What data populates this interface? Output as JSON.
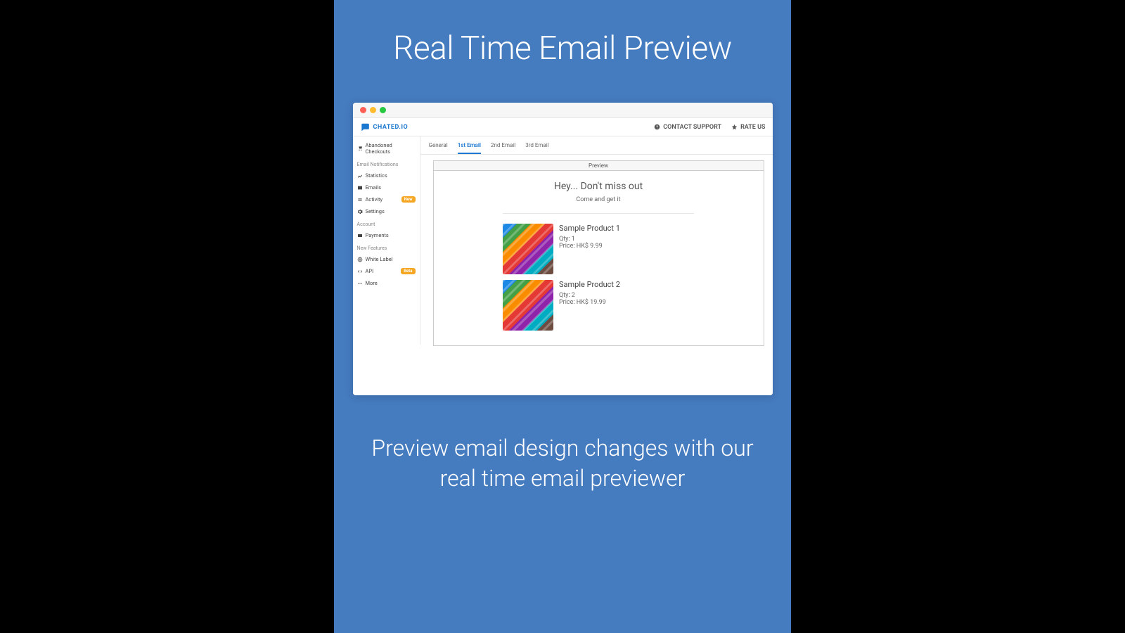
{
  "marketing": {
    "headline": "Real Time Email Preview",
    "caption": "Preview email design changes with our real time email previewer"
  },
  "brand": {
    "name": "CHATED.IO"
  },
  "topbar": {
    "contact": "CONTACT SUPPORT",
    "rate": "RATE US"
  },
  "sidebar": {
    "top_item": "Abandoned Checkouts",
    "groups": [
      {
        "label": "Email Notifications",
        "items": [
          {
            "label": "Statistics",
            "badge": null
          },
          {
            "label": "Emails",
            "badge": null
          },
          {
            "label": "Activity",
            "badge": "New"
          },
          {
            "label": "Settings",
            "badge": null
          }
        ]
      },
      {
        "label": "Account",
        "items": [
          {
            "label": "Payments",
            "badge": null
          }
        ]
      },
      {
        "label": "New Features",
        "items": [
          {
            "label": "White Label",
            "badge": null
          },
          {
            "label": "API",
            "badge": "Beta"
          },
          {
            "label": "More",
            "badge": null
          }
        ]
      }
    ]
  },
  "tabs": {
    "items": [
      "General",
      "1st Email",
      "2nd Email",
      "3rd Email"
    ],
    "active_index": 1
  },
  "preview": {
    "panel_label": "Preview",
    "email_heading": "Hey... Don't miss out",
    "email_subheading": "Come and get it",
    "products": [
      {
        "name": "Sample Product 1",
        "qty": "Qty: 1",
        "price": "Price: HK$ 9.99"
      },
      {
        "name": "Sample Product 2",
        "qty": "Qty: 2",
        "price": "Price: HK$ 19.99"
      }
    ]
  }
}
